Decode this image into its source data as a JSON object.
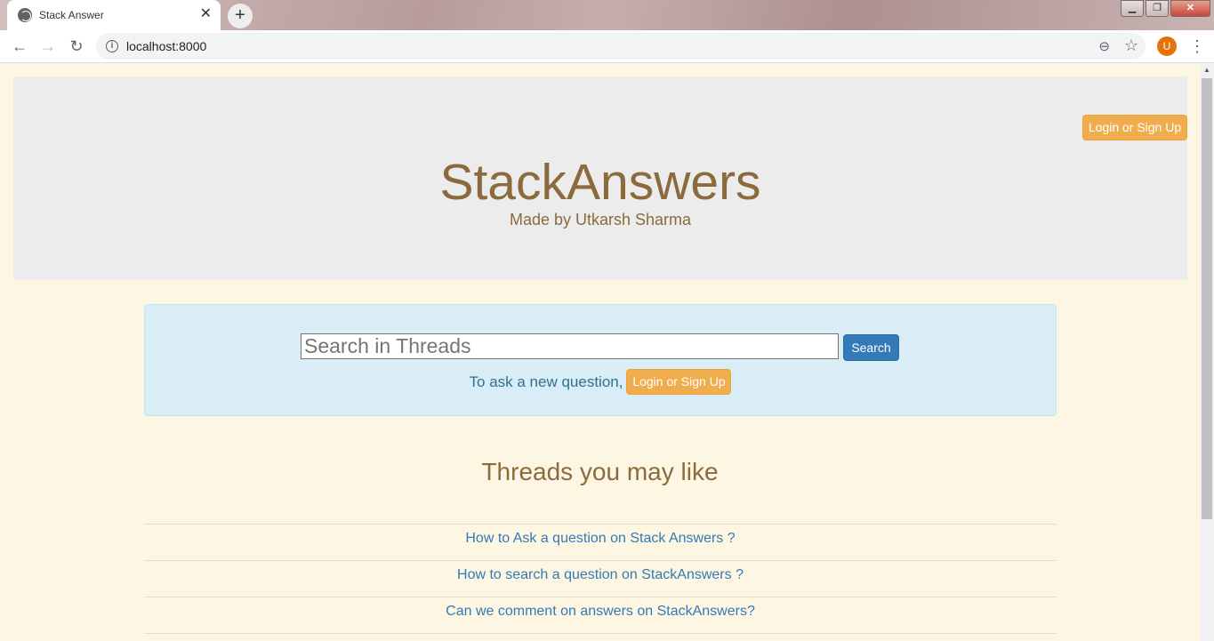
{
  "browser": {
    "tab_title": "Stack Answer",
    "tab_close": "✕",
    "new_tab": "+",
    "url": "localhost:8000",
    "avatar_letter": "U",
    "window_buttons": {
      "minimize": "▁",
      "restore": "❐",
      "close": "✕"
    }
  },
  "header": {
    "brand": "StackAnswers",
    "byline": "Made by Utkarsh Sharma",
    "login_label": "Login or Sign Up"
  },
  "search": {
    "placeholder": "Search in Threads",
    "button_label": "Search",
    "ask_text": "To ask a new question,",
    "login_label": "Login or Sign Up"
  },
  "threads": {
    "heading": "Threads you may like",
    "items": [
      "How to Ask a question on Stack Answers ?",
      "How to search a question on StackAnswers ?",
      "Can we comment on answers on StackAnswers?"
    ]
  },
  "colors": {
    "brand_text": "#8b6b3d",
    "warning_button": "#f0ad4e",
    "primary_button": "#337ab7",
    "panel_bg": "#d9edf7",
    "page_bg": "#fdf6e3"
  }
}
